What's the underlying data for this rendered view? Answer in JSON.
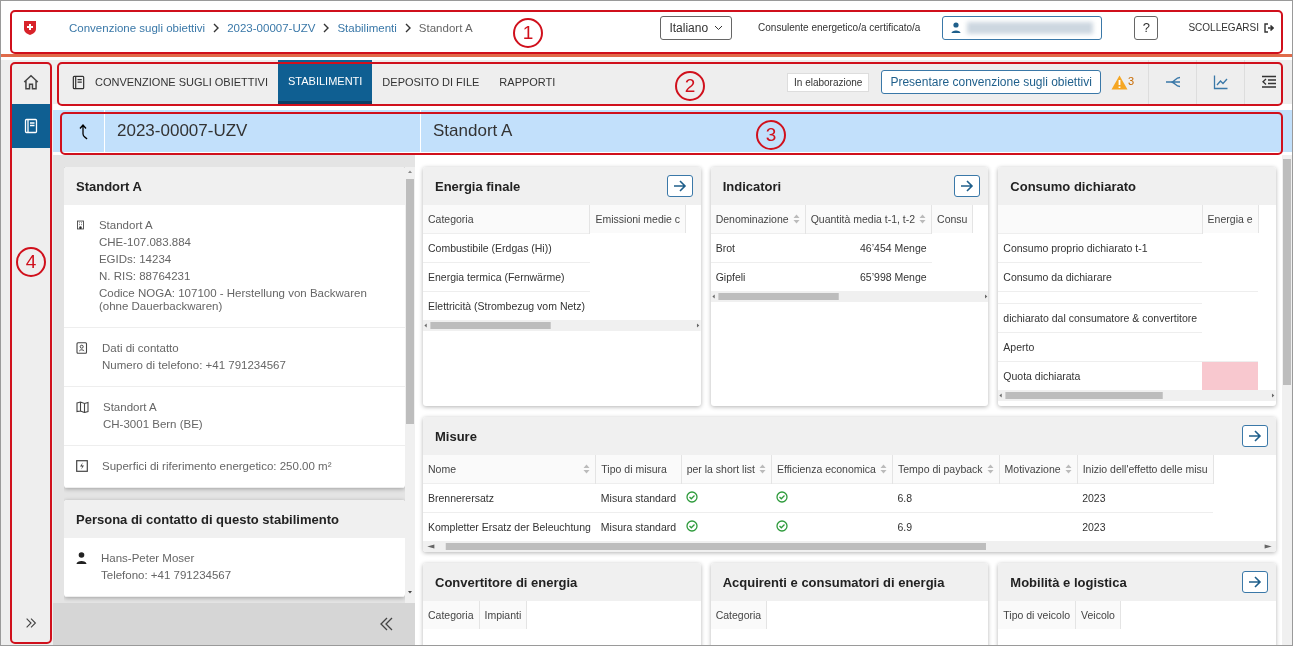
{
  "header": {
    "breadcrumb": [
      {
        "label": "Convenzione sugli obiettivi",
        "current": false
      },
      {
        "label": "2023-00007-UZV",
        "current": false
      },
      {
        "label": "Stabilimenti",
        "current": false
      },
      {
        "label": "Standort A",
        "current": true
      }
    ],
    "language": "Italiano",
    "role": "Consulente energetico/a certificato/a",
    "help": "?",
    "logout": "SCOLLEGARSI"
  },
  "rail": [
    {
      "kind": "home",
      "selected": false
    },
    {
      "kind": "book",
      "selected": true
    }
  ],
  "tabs": [
    {
      "label": "CONVENZIONE SUGLI OBIETTIVI",
      "selected": false
    },
    {
      "label": "STABILIMENTI",
      "selected": true
    },
    {
      "label": "DEPOSITO DI FILE",
      "selected": false
    },
    {
      "label": "RAPPORTI",
      "selected": false
    }
  ],
  "status": "In elaborazione",
  "submit_button": "Presentare convenzione sugli obiettivi",
  "warning_count": "3",
  "title_bar": {
    "number": "2023-00007-UZV",
    "name": "Standort A"
  },
  "site_card": {
    "title": "Standort A",
    "sections": [
      {
        "kind": "building",
        "lines": [
          "Standort A",
          "CHE-107.083.884",
          "EGIDs: 14234",
          "N. RIS: 88764231",
          "Codice NOGA: 107100 - Herstellung von Backwaren (ohne Dauerbackwaren)"
        ]
      },
      {
        "kind": "contact",
        "lines": [
          "Dati di contatto",
          "Numero di telefono: +41 791234567"
        ]
      },
      {
        "kind": "map",
        "lines": [
          "Standort A",
          "CH-3001 Bern (BE)"
        ]
      },
      {
        "kind": "energy",
        "lines": [
          "Superfici di riferimento energetico: 250.00 m²"
        ]
      }
    ]
  },
  "contact_card": {
    "title": "Persona di contatto di questo stabilimento",
    "lines": [
      "Hans-Peter Moser",
      "Telefono: +41 791234567"
    ]
  },
  "cards": [
    {
      "title": "Energia finale",
      "link": true,
      "columns": [
        {
          "label": "Categoria",
          "sortable": false
        },
        {
          "label": "Emissioni medie c",
          "sortable": false
        }
      ],
      "rows": [
        {
          "kind": "data",
          "cells": [
            {
              "kind": "text",
              "text": "Combustibile (Erdgas (Hi))"
            }
          ]
        },
        {
          "kind": "data",
          "cells": [
            {
              "kind": "text",
              "text": "Energia termica (Fernwärme)"
            }
          ]
        },
        {
          "kind": "data",
          "cells": [
            {
              "kind": "text",
              "text": "Elettricità (Strombezug vom Netz)"
            }
          ]
        }
      ]
    },
    {
      "title": "Indicatori",
      "link": true,
      "columns": [
        {
          "label": "Denominazione",
          "sortable": true
        },
        {
          "label": "Quantità media t-1, t-2",
          "sortable": true
        },
        {
          "label": "Consu",
          "sortable": false
        }
      ],
      "rows": [
        {
          "kind": "data",
          "cells": [
            {
              "kind": "text",
              "text": "Brot"
            },
            {
              "kind": "number",
              "text": "46’454 Menge"
            }
          ]
        },
        {
          "kind": "data",
          "cells": [
            {
              "kind": "text",
              "text": "Gipfeli"
            },
            {
              "kind": "number",
              "text": "65’998 Menge"
            }
          ]
        }
      ]
    },
    {
      "title": "Consumo dichiarato",
      "link": false,
      "columns": [
        {
          "sortable": false
        },
        {
          "label": "Energia e",
          "sortable": false
        }
      ],
      "rows": [
        {
          "kind": "data",
          "cells": [
            {
              "kind": "text",
              "text": "Consumo proprio dichiarato t-1"
            }
          ]
        },
        {
          "kind": "data",
          "cells": [
            {
              "kind": "text",
              "text": "Consumo da dichiarare"
            }
          ]
        },
        {
          "kind": "spacer"
        },
        {
          "kind": "data",
          "cells": [
            {
              "kind": "text",
              "text": "dichiarato dal consumatore & convertitore"
            }
          ]
        },
        {
          "kind": "data",
          "cells": [
            {
              "kind": "text",
              "text": "Aperto"
            }
          ]
        },
        {
          "kind": "data",
          "cells": [
            {
              "kind": "text",
              "text": "Quota dichiarata"
            },
            {
              "kind": "alert"
            }
          ]
        }
      ]
    }
  ],
  "measures": {
    "title": "Misure",
    "link": true,
    "columns": [
      {
        "label": "Nome",
        "sortable": true
      },
      {
        "label": "Tipo di misura",
        "sortable": false
      },
      {
        "label": "per la short list",
        "sortable": true
      },
      {
        "label": "Efficienza economica",
        "sortable": true
      },
      {
        "label": "Tempo di payback",
        "sortable": true
      },
      {
        "label": "Motivazione",
        "sortable": true
      },
      {
        "label": "Inizio dell'effetto delle misu",
        "sortable": false
      }
    ],
    "rows": [
      {
        "kind": "data",
        "cells": [
          {
            "kind": "text",
            "text": "Brennerersatz"
          },
          {
            "kind": "text",
            "text": "Misura standard"
          },
          {
            "kind": "check"
          },
          {
            "kind": "check"
          },
          {
            "kind": "text",
            "text": "6.8"
          },
          {
            "kind": "empty"
          },
          {
            "kind": "text",
            "text": "2023"
          }
        ]
      },
      {
        "kind": "data",
        "cells": [
          {
            "kind": "text",
            "text": "Kompletter Ersatz der Beleuchtung"
          },
          {
            "kind": "text",
            "text": "Misura standard"
          },
          {
            "kind": "check"
          },
          {
            "kind": "check"
          },
          {
            "kind": "text",
            "text": "6.9"
          },
          {
            "kind": "empty"
          },
          {
            "kind": "text",
            "text": "2023"
          }
        ]
      }
    ]
  },
  "bottom_cards": [
    {
      "title": "Convertitore di energia",
      "link": false,
      "columns": [
        {
          "label": "Categoria",
          "sortable": false
        },
        {
          "label": "Impianti",
          "sortable": false
        }
      ]
    },
    {
      "title": "Acquirenti e consumatori di energia",
      "link": false,
      "columns": [
        {
          "label": "Categoria",
          "sortable": false
        }
      ]
    },
    {
      "title": "Mobilità e logistica",
      "link": true,
      "columns": [
        {
          "label": "Tipo di veicolo",
          "sortable": false
        },
        {
          "label": "Veicolo",
          "sortable": false
        }
      ]
    }
  ],
  "annotations": [
    {
      "number": "1"
    },
    {
      "number": "2"
    },
    {
      "number": "3"
    },
    {
      "number": "4"
    }
  ]
}
